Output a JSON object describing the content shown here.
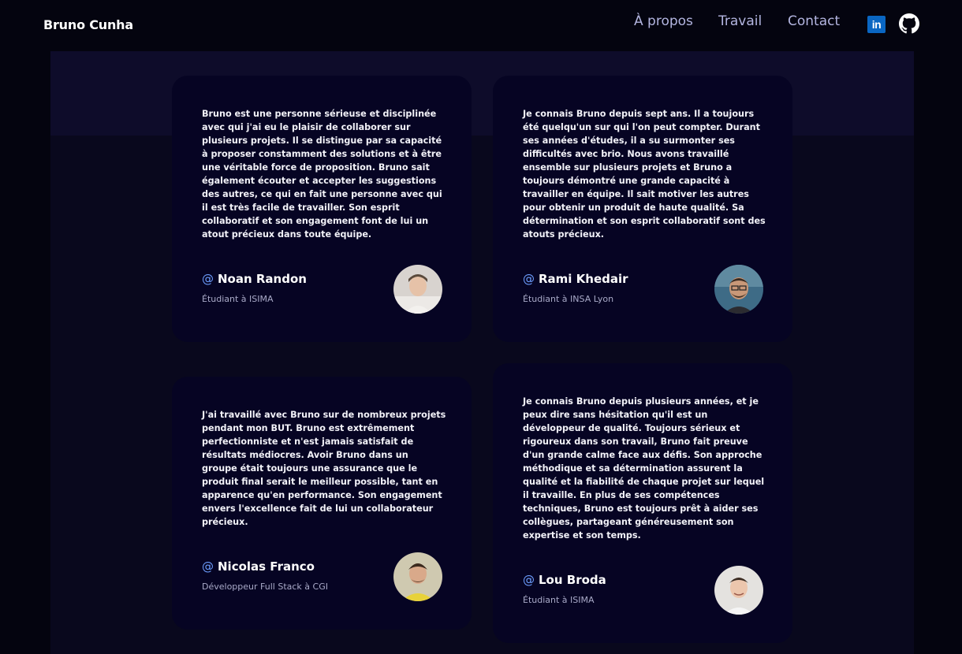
{
  "header": {
    "brand": "Bruno Cunha",
    "nav": [
      "À propos",
      "Travail",
      "Contact"
    ],
    "social": {
      "linkedin": "linkedin-icon",
      "github": "github-icon"
    }
  },
  "testimonials": [
    {
      "text": "Bruno est une personne sérieuse et disciplinée avec qui j'ai eu le plaisir de collaborer sur plusieurs projets. Il se distingue par sa capacité à proposer constamment des solutions et à être une véritable force de proposition. Bruno sait également écouter et accepter les suggestions des autres, ce qui en fait une personne avec qui il est très facile de travailler. Son esprit collaboratif et son engagement font de lui un atout précieux dans toute équipe.",
      "author": "Noan Randon",
      "role": "Étudiant à ISIMA"
    },
    {
      "text": "Je connais Bruno depuis sept ans. Il a toujours été quelqu'un sur qui l'on peut compter. Durant ses années d'études, il a su surmonter ses difficultés avec brio. Nous avons travaillé ensemble sur plusieurs projets et Bruno a toujours démontré une grande capacité à travailler en équipe. Il sait motiver les autres pour obtenir un produit de haute qualité. Sa détermination et son esprit collaboratif sont des atouts précieux.",
      "author": "Rami Khedair",
      "role": "Étudiant à INSA Lyon"
    },
    {
      "text": "J'ai travaillé avec Bruno sur de nombreux projets pendant mon BUT. Bruno est extrêmement perfectionniste et n'est jamais satisfait de résultats médiocres. Avoir Bruno dans un groupe était toujours une assurance que le produit final serait le meilleur possible, tant en apparence qu'en performance. Son engagement envers l'excellence fait de lui un collaborateur précieux.",
      "author": "Nicolas Franco",
      "role": "Développeur Full Stack à CGI"
    },
    {
      "text": "Je connais Bruno depuis plusieurs années, et je peux dire sans hésitation qu'il est un développeur de qualité. Toujours sérieux et rigoureux dans son travail, Bruno fait preuve d'un grande calme face aux défis. Son approche méthodique et sa détermination assurent la qualité et la fiabilité de chaque projet sur lequel il travaille. En plus de ses compétences techniques, Bruno est toujours prêt à aider ses collègues, partageant généreusement son expertise et son temps.",
      "author": "Lou Broda",
      "role": "Étudiant à ISIMA"
    }
  ],
  "at_symbol": "@",
  "colors": {
    "background": "#04040f",
    "card": "#060423",
    "accent": "#6d9eff",
    "nav": "#b3b5e0"
  }
}
